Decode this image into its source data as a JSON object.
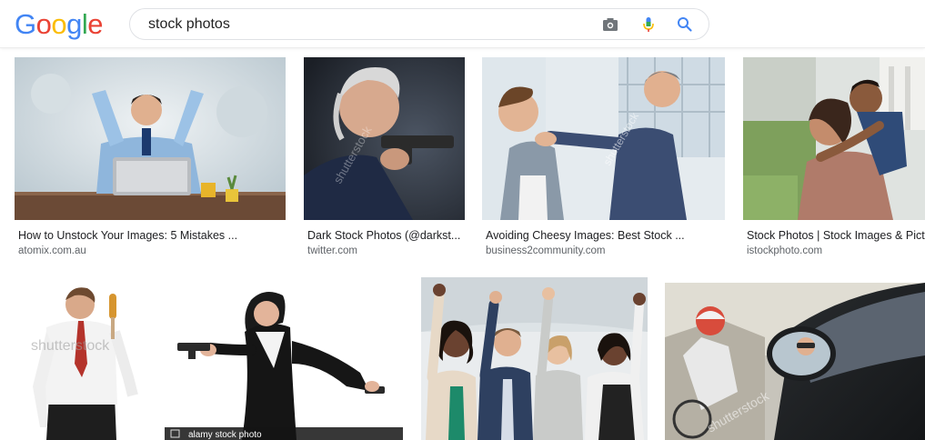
{
  "header": {
    "logo": [
      "G",
      "o",
      "o",
      "g",
      "l",
      "e"
    ],
    "logo_colors": [
      "#4285F4",
      "#EA4335",
      "#FBBC05",
      "#4285F4",
      "#34A853",
      "#EA4335"
    ],
    "search_value": "stock photos",
    "camera_icon": "camera-icon",
    "mic_icon": "mic-icon",
    "search_icon": "search-icon"
  },
  "results": [
    {
      "caption": "How to Unstock Your Images: 5 Mistakes ...",
      "domain": "atomix.com.au"
    },
    {
      "caption": "Dark Stock Photos (@darkst...",
      "domain": "twitter.com"
    },
    {
      "caption": "Avoiding Cheesy Images: Best Stock ...",
      "domain": "business2community.com"
    },
    {
      "caption": "Stock Photos | Stock Images & Pictu",
      "domain": "istockphoto.com"
    }
  ],
  "watermarks": {
    "shutterstock": "shutterstock",
    "alamy_bar": "alamy stock photo"
  },
  "colors": {
    "caption": "#202124",
    "domain": "#5f6368",
    "search_border": "#dfe1e5",
    "search_blue": "#4285F4"
  }
}
